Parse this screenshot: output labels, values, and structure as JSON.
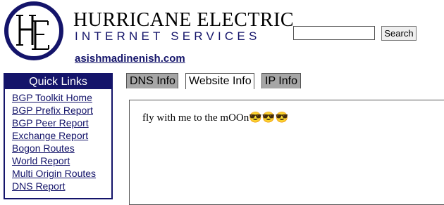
{
  "header": {
    "logo_letters": "HE",
    "brand_line1": "HURRICANE ELECTRIC",
    "brand_line2": "INTERNET SERVICES"
  },
  "search": {
    "value": "",
    "placeholder": "",
    "button_label": "Search"
  },
  "domain": "asishmadinenish.com",
  "quick_links": {
    "title": "Quick Links",
    "items": [
      "BGP Toolkit Home",
      "BGP Prefix Report",
      "BGP Peer Report",
      "Exchange Report",
      "Bogon Routes",
      "World Report",
      "Multi Origin Routes",
      "DNS Report"
    ]
  },
  "tabs": [
    {
      "label": "DNS Info",
      "active": false
    },
    {
      "label": "Website Info",
      "active": true
    },
    {
      "label": "IP Info",
      "active": false
    }
  ],
  "website_info": {
    "text": "fly with me to the mOOn😎😎😎"
  },
  "colors": {
    "brand_navy": "#14146a",
    "inactive_tab": "#a6a6a6"
  }
}
